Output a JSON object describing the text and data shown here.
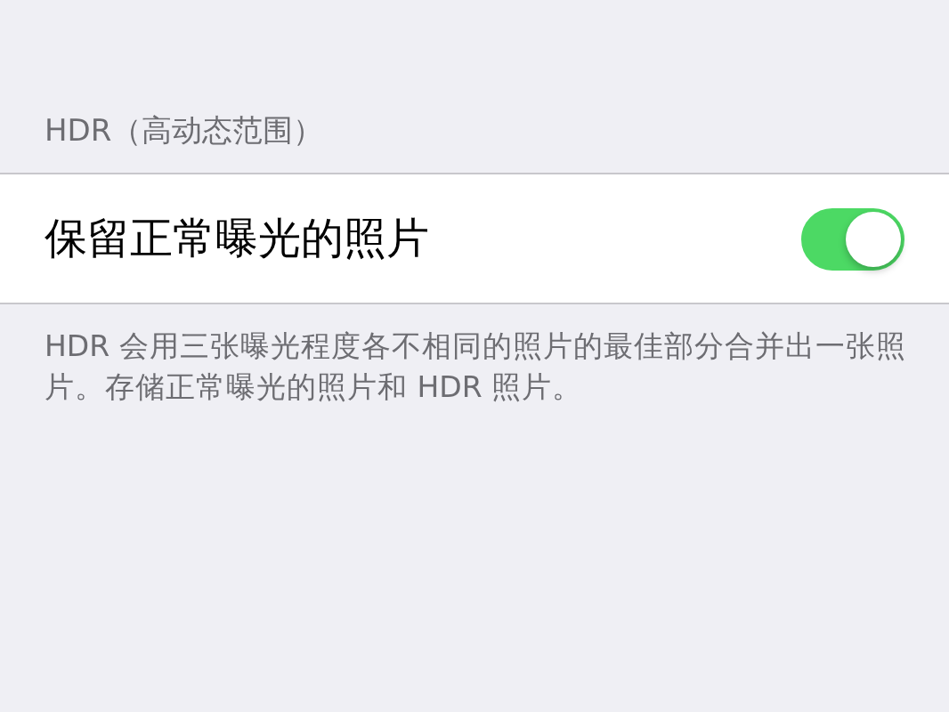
{
  "section": {
    "header": "HDR（高动态范围）",
    "rows": [
      {
        "kind": "switch",
        "label": "保留正常曝光的照片",
        "on": true
      }
    ],
    "footer": "HDR 会用三张曝光程度各不相同的照片的最佳部分合并出一张照片。存储正常曝光的照片和 HDR 照片。"
  }
}
